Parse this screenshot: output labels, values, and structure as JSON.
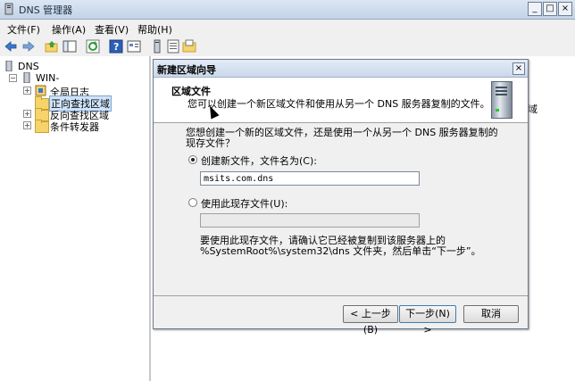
{
  "window": {
    "title": "DNS 管理器"
  },
  "menu": [
    "文件(F)",
    "操作(A)",
    "查看(V)",
    "帮助(H)"
  ],
  "tree": {
    "root": "DNS",
    "server": "WIN-",
    "items": [
      "全局日志",
      "正向查找区域",
      "反向查找区域",
      "条件转发器"
    ]
  },
  "right_pane": {
    "stray_text": "域"
  },
  "dialog": {
    "title": "新建区域向导",
    "heading": "区域文件",
    "description": "您可以创建一个新区域文件和使用从另一个 DNS 服务器复制的文件。",
    "question": "您想创建一个新的区域文件，还是使用一个从另一个 DNS 服务器复制的现存文件？",
    "option_create": {
      "label": "创建新文件，文件名为(C):",
      "value": "msits.com.dns",
      "selected": true
    },
    "option_existing": {
      "label": "使用此现存文件(U):",
      "value": "",
      "selected": false
    },
    "note": "要使用此现存文件，请确认它已经被复制到该服务器上的 %SystemRoot%\\system32\\dns 文件夹，然后单击“下一步”。",
    "buttons": {
      "back": "< 上一步(B)",
      "next": "下一步(N) >",
      "cancel": "取消"
    }
  }
}
